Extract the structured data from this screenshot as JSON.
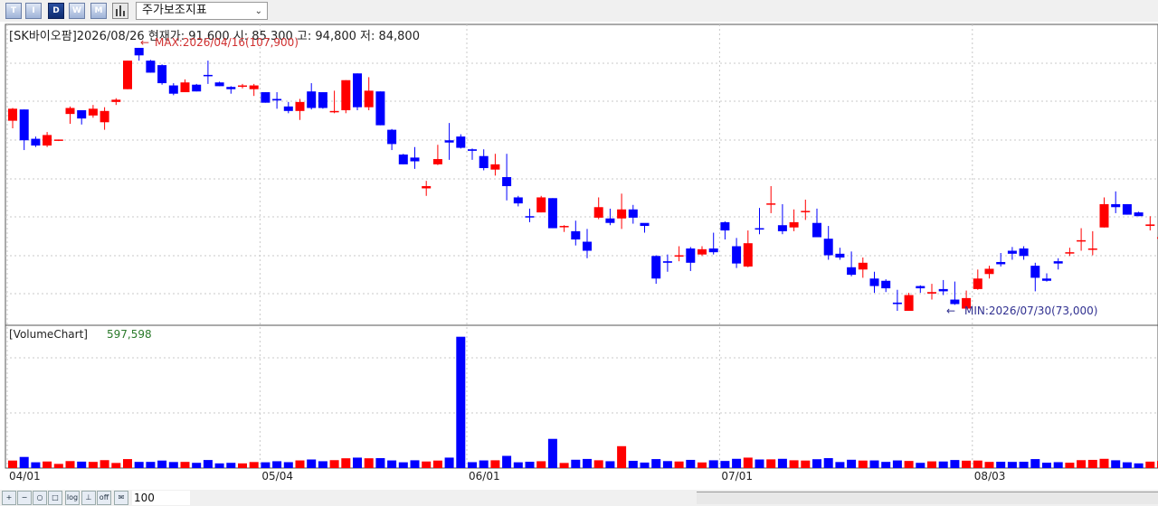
{
  "toolbar": {
    "buttons": [
      {
        "label": "T",
        "active": false
      },
      {
        "label": "I",
        "active": false
      },
      {
        "label": "D",
        "active": true
      },
      {
        "label": "W",
        "active": false
      },
      {
        "label": "M",
        "active": false
      }
    ],
    "select_value": "주가보조지표"
  },
  "bottombar": {
    "zoom_value": "100",
    "log_label": "log",
    "off_label": "off"
  },
  "colors": {
    "up": "#ff0000",
    "down": "#0000ff",
    "max_label": "#d03030",
    "min_label": "#303090",
    "volume_value": "#2a7a2a"
  },
  "chart_data": [
    {
      "type": "candlestick",
      "title": "[SK바이오팜]2026/08/26 현재가: 91,600 시: 85,300 고: 94,800 저: 84,800",
      "max_label": "MAX:2026/04/16(107,900)",
      "min_label": "MIN:2026/07/30(73,000)",
      "x_ticks": [
        {
          "index": 0,
          "label": "04/01"
        },
        {
          "index": 22,
          "label": "05/04"
        },
        {
          "index": 40,
          "label": "06/01"
        },
        {
          "index": 62,
          "label": "07/01"
        },
        {
          "index": 84,
          "label": "08/03"
        }
      ],
      "ylim": [
        72000,
        110000
      ],
      "grid": true,
      "ohlc": [
        [
          98500,
          100200,
          97500,
          100100
        ],
        [
          100000,
          100000,
          94600,
          95900
        ],
        [
          96100,
          96400,
          95000,
          95200
        ],
        [
          95200,
          97000,
          95000,
          96600
        ],
        [
          95900,
          96000,
          95800,
          96000
        ],
        [
          99400,
          100400,
          98100,
          100200
        ],
        [
          99900,
          99900,
          98000,
          98800
        ],
        [
          99200,
          100600,
          98900,
          100100
        ],
        [
          98300,
          100300,
          97300,
          99800
        ],
        [
          101000,
          101500,
          100600,
          101300
        ],
        [
          102700,
          106500,
          102700,
          106500
        ],
        [
          108200,
          108200,
          106500,
          107200
        ],
        [
          106500,
          106600,
          104900,
          104900
        ],
        [
          105900,
          106000,
          103300,
          103500
        ],
        [
          103200,
          103500,
          101900,
          102100
        ],
        [
          102300,
          104000,
          102300,
          103600
        ],
        [
          103300,
          103400,
          102400,
          102400
        ],
        [
          104600,
          106500,
          103400,
          104500
        ],
        [
          103600,
          103700,
          103100,
          103100
        ],
        [
          103000,
          103100,
          102100,
          102700
        ],
        [
          103200,
          103400,
          102800,
          103200
        ],
        [
          102700,
          103400,
          101800,
          103200
        ],
        [
          102300,
          102300,
          100900,
          100900
        ],
        [
          101400,
          102300,
          100100,
          101200
        ],
        [
          100400,
          101000,
          99500,
          99800
        ],
        [
          99800,
          101400,
          98600,
          101000
        ],
        [
          102400,
          103500,
          100000,
          100200
        ],
        [
          102300,
          102300,
          100100,
          100200
        ],
        [
          99700,
          102500,
          99500,
          99800
        ],
        [
          99900,
          103900,
          99500,
          103900
        ],
        [
          104800,
          104800,
          99900,
          100300
        ],
        [
          100300,
          104300,
          99900,
          102500
        ],
        [
          102400,
          102400,
          97900,
          97900
        ],
        [
          97300,
          97400,
          94600,
          95400
        ],
        [
          94000,
          94100,
          92700,
          92700
        ],
        [
          93600,
          95000,
          92100,
          93100
        ],
        [
          89500,
          90500,
          88500,
          89800
        ],
        [
          92700,
          95300,
          92600,
          93400
        ],
        [
          95900,
          98200,
          93300,
          95600
        ],
        [
          96400,
          96700,
          94800,
          94900
        ],
        [
          94700,
          94800,
          93300,
          94500
        ],
        [
          93800,
          94700,
          91900,
          92200
        ],
        [
          92000,
          94100,
          91200,
          92700
        ],
        [
          91000,
          94100,
          87900,
          89800
        ],
        [
          88300,
          88500,
          87100,
          87500
        ],
        [
          85800,
          86800,
          85000,
          85700
        ],
        [
          86300,
          88500,
          86300,
          88300
        ],
        [
          88200,
          88200,
          84200,
          84200
        ],
        [
          84400,
          84600,
          83700,
          84500
        ],
        [
          83800,
          85200,
          81900,
          82700
        ],
        [
          82400,
          84100,
          80200,
          81200
        ],
        [
          85600,
          88300,
          85400,
          87000
        ],
        [
          85500,
          86800,
          84600,
          84900
        ],
        [
          85500,
          88800,
          84100,
          86700
        ],
        [
          86700,
          87300,
          84800,
          85600
        ],
        [
          84900,
          84800,
          83600,
          84500
        ],
        [
          80500,
          80600,
          76800,
          77500
        ],
        [
          79800,
          80700,
          78400,
          79600
        ],
        [
          80600,
          81800,
          79800,
          80600
        ],
        [
          81500,
          81700,
          78500,
          79600
        ],
        [
          80700,
          81800,
          80500,
          81400
        ],
        [
          81500,
          83600,
          80700,
          81000
        ],
        [
          85000,
          85100,
          82700,
          83900
        ],
        [
          81800,
          82900,
          78900,
          79500
        ],
        [
          79100,
          83900,
          79000,
          82200
        ],
        [
          84200,
          86900,
          83400,
          84100
        ],
        [
          87400,
          89800,
          86200,
          87500
        ],
        [
          84600,
          87400,
          83400,
          83800
        ],
        [
          84300,
          86700,
          83800,
          85000
        ],
        [
          86500,
          88000,
          85300,
          86500
        ],
        [
          84900,
          86800,
          83100,
          83000
        ],
        [
          82800,
          84500,
          80000,
          80600
        ],
        [
          80800,
          81600,
          80000,
          80300
        ],
        [
          79000,
          81100,
          77800,
          78000
        ],
        [
          78700,
          80300,
          77600,
          79600
        ],
        [
          77500,
          78400,
          75600,
          76500
        ],
        [
          77200,
          77400,
          75700,
          76200
        ],
        [
          74300,
          76000,
          73200,
          74100
        ],
        [
          73200,
          75600,
          73200,
          75300
        ],
        [
          76500,
          76600,
          75600,
          76200
        ],
        [
          75500,
          76800,
          74700,
          75700
        ],
        [
          76100,
          77300,
          75300,
          75800
        ],
        [
          74700,
          77100,
          74000,
          74100
        ],
        [
          73500,
          75900,
          73300,
          74900
        ],
        [
          76100,
          78700,
          76000,
          77500
        ],
        [
          78100,
          79200,
          77500,
          78800
        ],
        [
          79700,
          80900,
          79100,
          79400
        ],
        [
          81200,
          81700,
          80000,
          80800
        ],
        [
          81500,
          81800,
          80000,
          80500
        ],
        [
          79200,
          79600,
          75800,
          77600
        ]
      ],
      "ohlc_tail": [
        [
          77500,
          78200,
          77100,
          77200
        ],
        [
          79800,
          80200,
          78700,
          79500
        ],
        [
          81000,
          81600,
          80500,
          81000
        ],
        [
          82600,
          84200,
          81200,
          82600
        ],
        [
          81500,
          83800,
          80600,
          81500
        ],
        [
          84300,
          88300,
          84300,
          87400
        ],
        [
          87400,
          89100,
          86200,
          87000
        ],
        [
          87400,
          87400,
          86000,
          86000
        ],
        [
          86300,
          86400,
          85800,
          85800
        ],
        [
          84500,
          85800,
          83900,
          84700
        ]
      ],
      "ohlc_end": [
        [
          82800,
          84000,
          81600,
          83000
        ],
        [
          83700,
          86600,
          83100,
          85000
        ],
        [
          83100,
          84300,
          80700,
          81600
        ],
        [
          82500,
          82500,
          82200,
          82500
        ],
        [
          82600,
          84200,
          82600,
          84200
        ],
        [
          82700,
          84200,
          81200,
          82800
        ],
        [
          80100,
          85600,
          80100,
          85600
        ],
        [
          86500,
          86900,
          85300,
          86000
        ],
        [
          85600,
          87000,
          85600,
          87000
        ],
        [
          85300,
          94800,
          84800,
          91600
        ]
      ]
    },
    {
      "type": "bar",
      "title": "[VolumeChart]",
      "value_label": "597,598",
      "max_volume": 5500000,
      "grid": true
    }
  ]
}
